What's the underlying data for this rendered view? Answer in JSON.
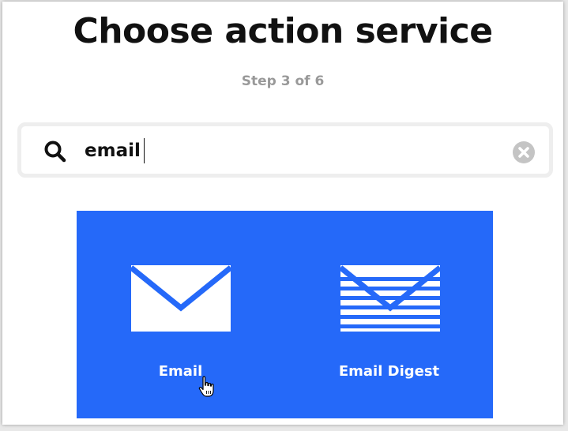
{
  "header": {
    "title": "Choose action service",
    "step": "Step 3 of 6"
  },
  "search": {
    "value": "email",
    "icon": "search-icon",
    "clear_icon": "clear-circle-icon"
  },
  "results": {
    "background_color": "#2569f9",
    "services": [
      {
        "label": "Email",
        "icon": "envelope-icon"
      },
      {
        "label": "Email Digest",
        "icon": "striped-envelope-icon"
      }
    ]
  }
}
